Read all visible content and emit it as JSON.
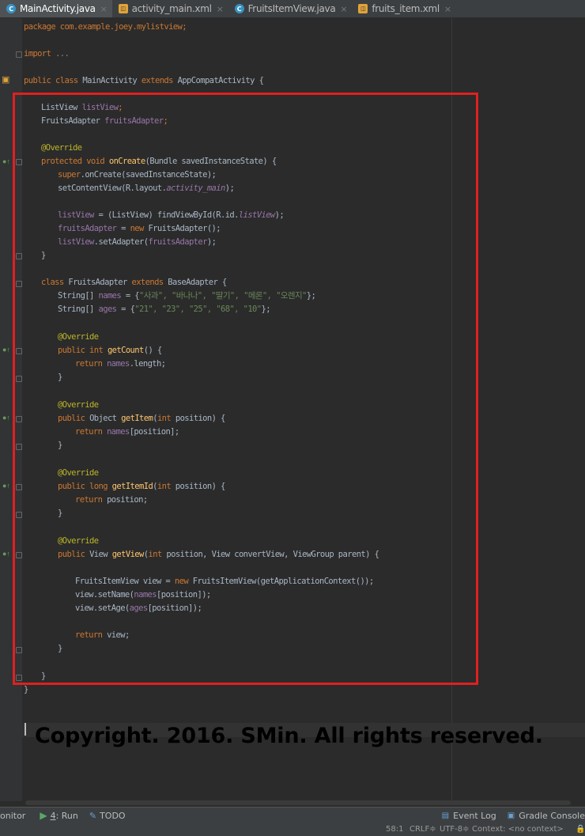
{
  "tabs": [
    {
      "label": "MainActivity.java",
      "icon": "java-class-icon",
      "active": true
    },
    {
      "label": "activity_main.xml",
      "icon": "xml-layout-icon",
      "active": false
    },
    {
      "label": "FruitsItemView.java",
      "icon": "java-class-icon",
      "active": false
    },
    {
      "label": "fruits_item.xml",
      "icon": "xml-layout-icon",
      "active": false
    }
  ],
  "code": {
    "l1": "package com.example.joey.mylistview;",
    "l3a": "import",
    "l3b": "...",
    "l5a": "public class",
    "l5b": "MainActivity",
    "l5c": "extends",
    "l5d": "AppCompatActivity {",
    "l7a": "ListView",
    "l7b": "listView",
    "l8a": "FruitsAdapter",
    "l8b": "fruitsAdapter",
    "l10": "@Override",
    "l11a": "protected void",
    "l11b": "onCreate",
    "l11c": "(Bundle savedInstanceState) {",
    "l12a": "super",
    "l12b": ".onCreate(savedInstanceState);",
    "l13a": "setContentView(R.layout.",
    "l13b": "activity_main",
    "l13c": ");",
    "l15a": "listView",
    "l15b": " = (ListView) findViewById(R.id.",
    "l15c": "listView",
    "l15d": ");",
    "l16a": "fruitsAdapter",
    "l16b": " = ",
    "l16c": "new",
    "l16d": " FruitsAdapter();",
    "l17a": "listView",
    "l17b": ".setAdapter(",
    "l17c": "fruitsAdapter",
    "l17d": ");",
    "l18": "}",
    "l20a": "class",
    "l20b": "FruitsAdapter",
    "l20c": "extends",
    "l20d": "BaseAdapter {",
    "l21a": "String[]",
    "l21b": "names",
    "l21c": " = {",
    "l21d": "\"사과\", \"바나나\", \"딸기\", \"메론\", \"오렌지\"",
    "l21e": "};",
    "l22a": "String[]",
    "l22b": "ages",
    "l22c": " = {",
    "l22d": "\"21\", \"23\", \"25\", \"68\", \"10\"",
    "l22e": "};",
    "l24": "@Override",
    "l25a": "public int",
    "l25b": "getCount",
    "l25c": "() {",
    "l26a": "return",
    "l26b": "names",
    "l26c": ".length;",
    "l27": "}",
    "l29": "@Override",
    "l30a": "public",
    "l30b": "Object",
    "l30c": "getItem",
    "l30d": "(",
    "l30e": "int",
    "l30f": " position) {",
    "l31a": "return",
    "l31b": "names",
    "l31c": "[position];",
    "l32": "}",
    "l34": "@Override",
    "l35a": "public long",
    "l35b": "getItemId",
    "l35c": "(",
    "l35d": "int",
    "l35e": " position) {",
    "l36a": "return",
    "l36b": " position;",
    "l37": "}",
    "l39": "@Override",
    "l40a": "public",
    "l40b": "View",
    "l40c": "getView",
    "l40d": "(",
    "l40e": "int",
    "l40f": " position, View convertView, ViewGroup parent) {",
    "l42a": "FruitsItemView view = ",
    "l42b": "new",
    "l42c": " FruitsItemView(getApplicationContext());",
    "l43a": "view.setName(",
    "l43b": "names",
    "l43c": "[position]);",
    "l44a": "view.setAge(",
    "l44b": "ages",
    "l44c": "[position]);",
    "l46a": "return",
    "l46b": " view;",
    "l47": "}",
    "l49": "}",
    "l50": "}"
  },
  "watermark": "Copyright. 2016. SMin. All rights reserved.",
  "toolbar": {
    "monitor": "onitor",
    "run_num": "4",
    "run": ": Run",
    "todo": "TODO",
    "event_log": "Event Log",
    "gradle_console": "Gradle Console"
  },
  "status": {
    "position": "58:1",
    "line_sep": "CRLF≑",
    "encoding": "UTF-8≑",
    "context": "Context: <no context>"
  },
  "colors": {
    "highlight_box": "#e02020",
    "editor_bg": "#2b2b2b"
  }
}
